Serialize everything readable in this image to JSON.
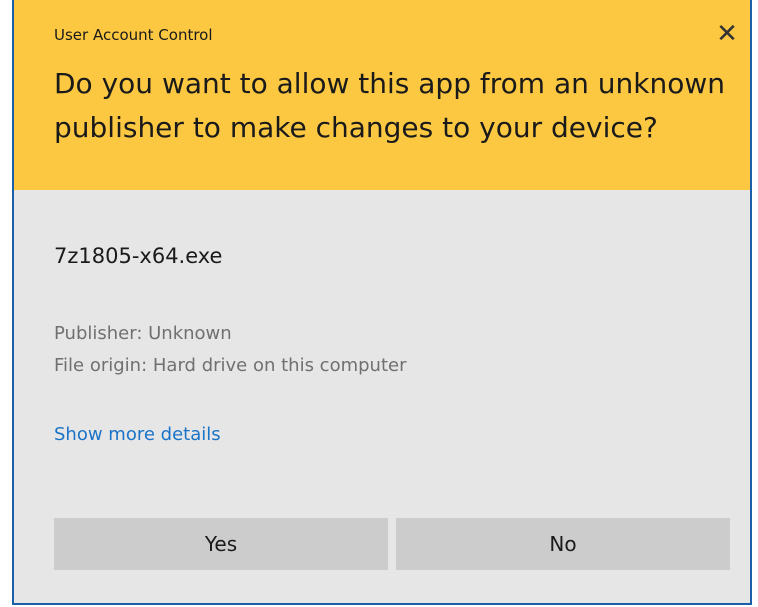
{
  "dialog": {
    "title": "User Account Control",
    "close_glyph": "✕",
    "close_icon": "close-icon",
    "question": "Do you want to allow this app from an unknown publisher to make changes to your device?",
    "filename": "7z1805-x64.exe",
    "publisher_label": "Publisher:",
    "publisher_value": "Unknown",
    "origin_label": "File origin:",
    "origin_value": "Hard drive on this computer",
    "details_link": "Show more details",
    "yes_label": "Yes",
    "no_label": "No"
  },
  "colors": {
    "header": "#fcc842",
    "body": "#e6e6e6",
    "button": "#cccccc",
    "link": "#1a73c8",
    "border": "#1b5fa8"
  }
}
